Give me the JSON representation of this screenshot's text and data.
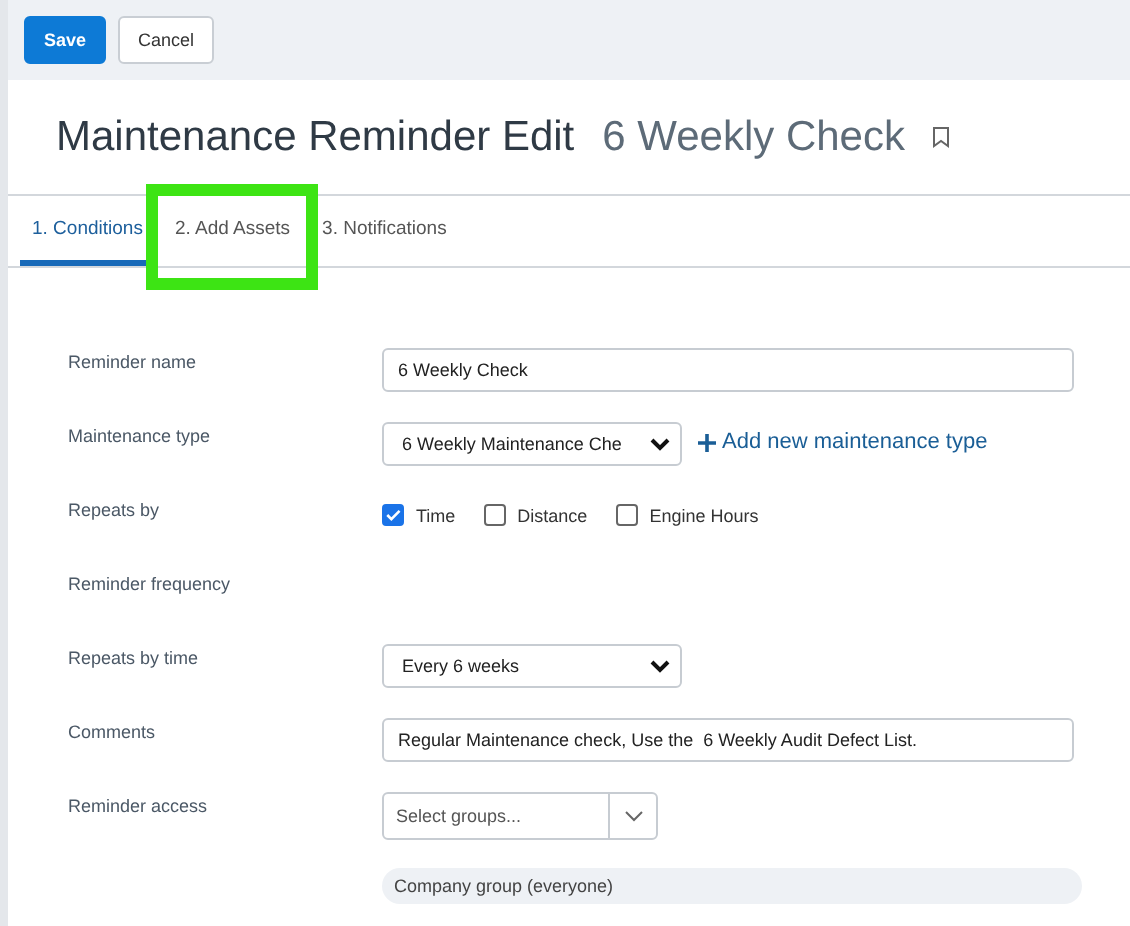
{
  "toolbar": {
    "buttons": [
      {
        "label": "Save",
        "kind": "primary"
      },
      {
        "label": "Cancel",
        "kind": "secondary"
      }
    ]
  },
  "header": {
    "title": "Maintenance Reminder Edit",
    "subtitle": "6 Weekly Check"
  },
  "tabs": [
    {
      "label": "1. Conditions",
      "selected": true,
      "highlighted": false
    },
    {
      "label": "2. Add Assets",
      "selected": false,
      "highlighted": true
    },
    {
      "label": "3. Notifications",
      "selected": false,
      "highlighted": false
    }
  ],
  "form": [
    {
      "label": "Reminder name",
      "kind": "text",
      "value": "6 Weekly Check"
    },
    {
      "label": "Maintenance type",
      "kind": "select",
      "value": "6 Weekly Maintenance Che",
      "link": "Add new maintenance type"
    },
    {
      "label": "Repeats by",
      "kind": "checkboxes",
      "options": [
        {
          "label": "Time",
          "checked": true
        },
        {
          "label": "Distance",
          "checked": false
        },
        {
          "label": "Engine Hours",
          "checked": false
        }
      ]
    },
    {
      "label": "Reminder frequency",
      "kind": "heading"
    },
    {
      "label": "Repeats by time",
      "kind": "select",
      "value": "Every 6 weeks"
    },
    {
      "label": "Comments",
      "kind": "text",
      "value": "Regular Maintenance check, Use the  6 Weekly Audit Defect List."
    },
    {
      "label": "Reminder access",
      "kind": "groups",
      "placeholder": "Select groups...",
      "chip": "Company group (everyone)"
    }
  ]
}
